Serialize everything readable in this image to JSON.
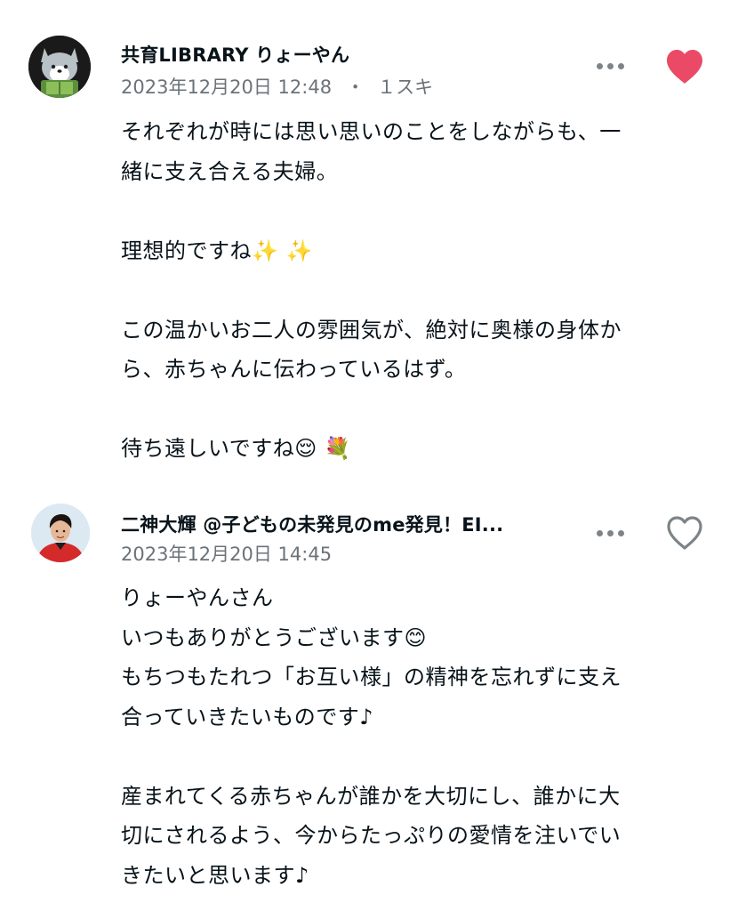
{
  "comments": [
    {
      "author": "共育LIBRARY りょーやん",
      "timestamp": "2023年12月20日 12:48",
      "separator": "・",
      "likes": "１スキ",
      "liked": true,
      "like_color": "#ea4a66",
      "icon_color": "#7d8488",
      "lines": [
        "それぞれが時には思い思いのことをしながらも、一",
        "緒に支え合える夫婦。",
        "",
        "理想的ですね✨ ✨",
        "",
        "この温かいお二人の雰囲気が、絶対に奥様の身体か",
        "ら、赤ちゃんに伝わっているはず。",
        "",
        "待ち遠しいですね😌 💐"
      ]
    },
    {
      "author": "二神大輝 @子どもの未発見のme発見！EI...",
      "timestamp": "2023年12月20日 14:45",
      "liked": false,
      "like_color": "#7d8488",
      "icon_color": "#7d8488",
      "lines": [
        "りょーやんさん",
        "いつもありがとうございます😊",
        "もちつもたれつ「お互い様」の精神を忘れずに支え",
        "合っていきたいものです♪",
        "",
        "産まれてくる赤ちゃんが誰かを大切にし、誰かに大",
        "切にされるよう、今からたっぷりの愛情を注いでい",
        "きたいと思います♪"
      ]
    }
  ]
}
